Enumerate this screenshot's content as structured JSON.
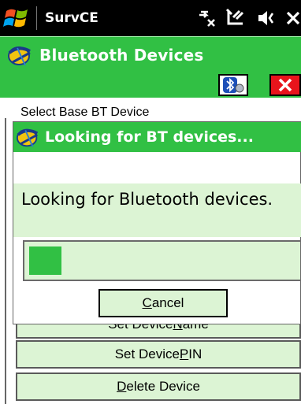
{
  "taskbar": {
    "title": "SurvCE"
  },
  "app": {
    "title": "Bluetooth Devices"
  },
  "background": {
    "label": "Select Base BT Device",
    "buttons": [
      {
        "pre": "Set Device ",
        "u": "N",
        "post": "ame"
      },
      {
        "pre": "Set Device ",
        "u": "P",
        "post": "IN"
      },
      {
        "pre": "",
        "u": "D",
        "post": "elete Device"
      }
    ]
  },
  "dialog": {
    "title": "Looking for BT devices...",
    "message": "Looking for Bluetooth devices.",
    "progress": 0.12,
    "cancel": {
      "u": "C",
      "post": "ancel"
    }
  },
  "colors": {
    "accent_green": "#31c044",
    "light_green": "#dcf4d4",
    "close_red": "#e8141c"
  }
}
